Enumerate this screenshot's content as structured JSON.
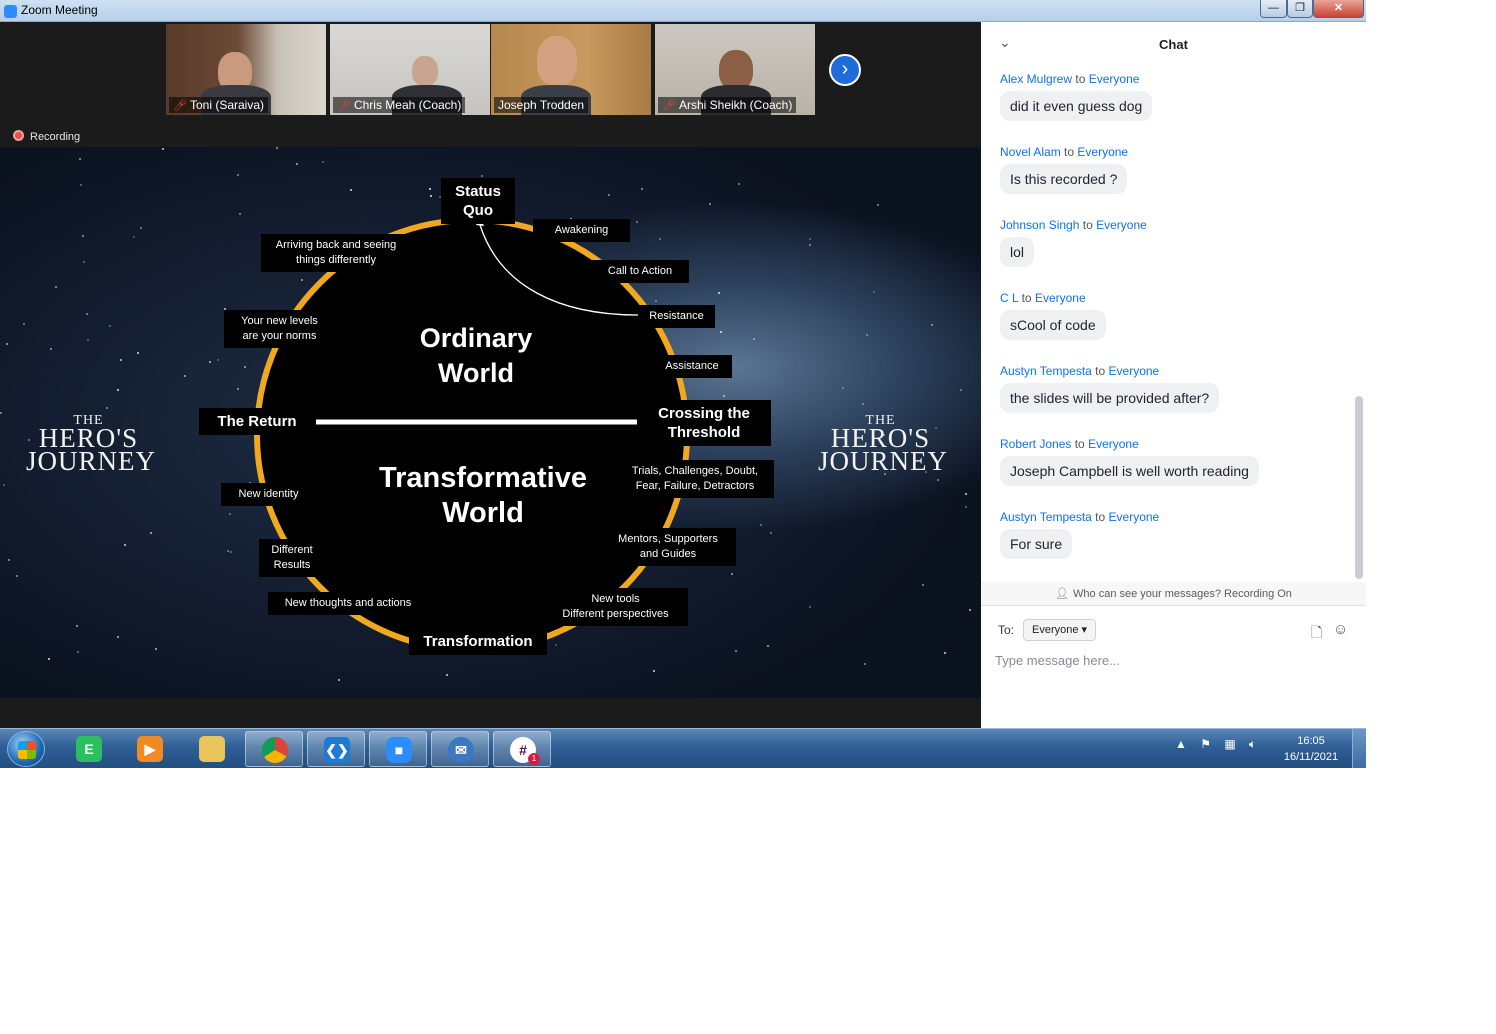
{
  "window": {
    "title": "Zoom Meeting",
    "min": "—",
    "max": "❐",
    "close": "✕"
  },
  "participants": [
    {
      "name": "Toni (Saraiva)",
      "muted": true
    },
    {
      "name": "Chris Meah (Coach)",
      "muted": true
    },
    {
      "name": "Joseph Trodden",
      "muted": false,
      "active": true
    },
    {
      "name": "Arshi Sheikh (Coach)",
      "muted": true
    }
  ],
  "recording_label": "Recording",
  "slide": {
    "logo": {
      "line1": "THE",
      "line2": "HERO'S",
      "line3": "JOURNEY"
    },
    "top_world": [
      "Ordinary",
      "World"
    ],
    "bottom_world": [
      "Transformative",
      "World"
    ],
    "labels": {
      "status_quo": [
        "Status",
        "Quo"
      ],
      "awakening": "Awakening",
      "call_to_action": "Call to Action",
      "resistance": "Resistance",
      "assistance": "Assistance",
      "crossing": [
        "Crossing the",
        "Threshold"
      ],
      "trials": [
        "Trials, Challenges, Doubt,",
        "Fear, Failure, Detractors"
      ],
      "mentors": [
        "Mentors, Supporters",
        "and Guides"
      ],
      "new_tools": [
        "New tools",
        "Different perspectives"
      ],
      "transformation": "Transformation",
      "new_thoughts": "New thoughts and actions",
      "different_results": [
        "Different",
        "Results"
      ],
      "new_identity": "New identity",
      "the_return": "The Return",
      "new_levels": [
        "Your new levels",
        "are your norms"
      ],
      "arriving_back": [
        "Arriving back and seeing",
        "things differently"
      ]
    },
    "colors": {
      "circle_ring": "#f0a820",
      "circle_fill": "#000000"
    }
  },
  "chat": {
    "title": "Chat",
    "to_word": "to",
    "messages": [
      {
        "sender": "Alex Mulgrew",
        "recipient": "Everyone",
        "text": "did it even guess dog"
      },
      {
        "sender": "Novel Alam",
        "recipient": "Everyone",
        "text": "Is this recorded ?"
      },
      {
        "sender": "Johnson Singh",
        "recipient": "Everyone",
        "text": "lol"
      },
      {
        "sender": "C L",
        "recipient": "Everyone",
        "text": "sCool of code"
      },
      {
        "sender": "Austyn Tempesta",
        "recipient": "Everyone",
        "text": "the slides will be provided after?"
      },
      {
        "sender": "Robert Jones",
        "recipient": "Everyone",
        "text": "Joseph Campbell is well worth reading"
      },
      {
        "sender": "Austyn Tempesta",
        "recipient": "Everyone",
        "text": "For sure"
      }
    ],
    "visibility_note": "Who can see your messages? Recording On",
    "to_label": "To:",
    "to_value": "Everyone",
    "input_placeholder": "Type message here..."
  },
  "taskbar": {
    "apps": [
      "evernote",
      "vlc",
      "file-explorer",
      "chrome",
      "vscode",
      "zoom",
      "thunderbird",
      "slack"
    ],
    "slack_badge": "1",
    "time": "16:05",
    "date": "16/11/2021"
  },
  "accent_colors": {
    "zoom_blue": "#2d8cff",
    "chat_name_blue": "#0e72ed",
    "active_speaker": "#d8d334"
  }
}
